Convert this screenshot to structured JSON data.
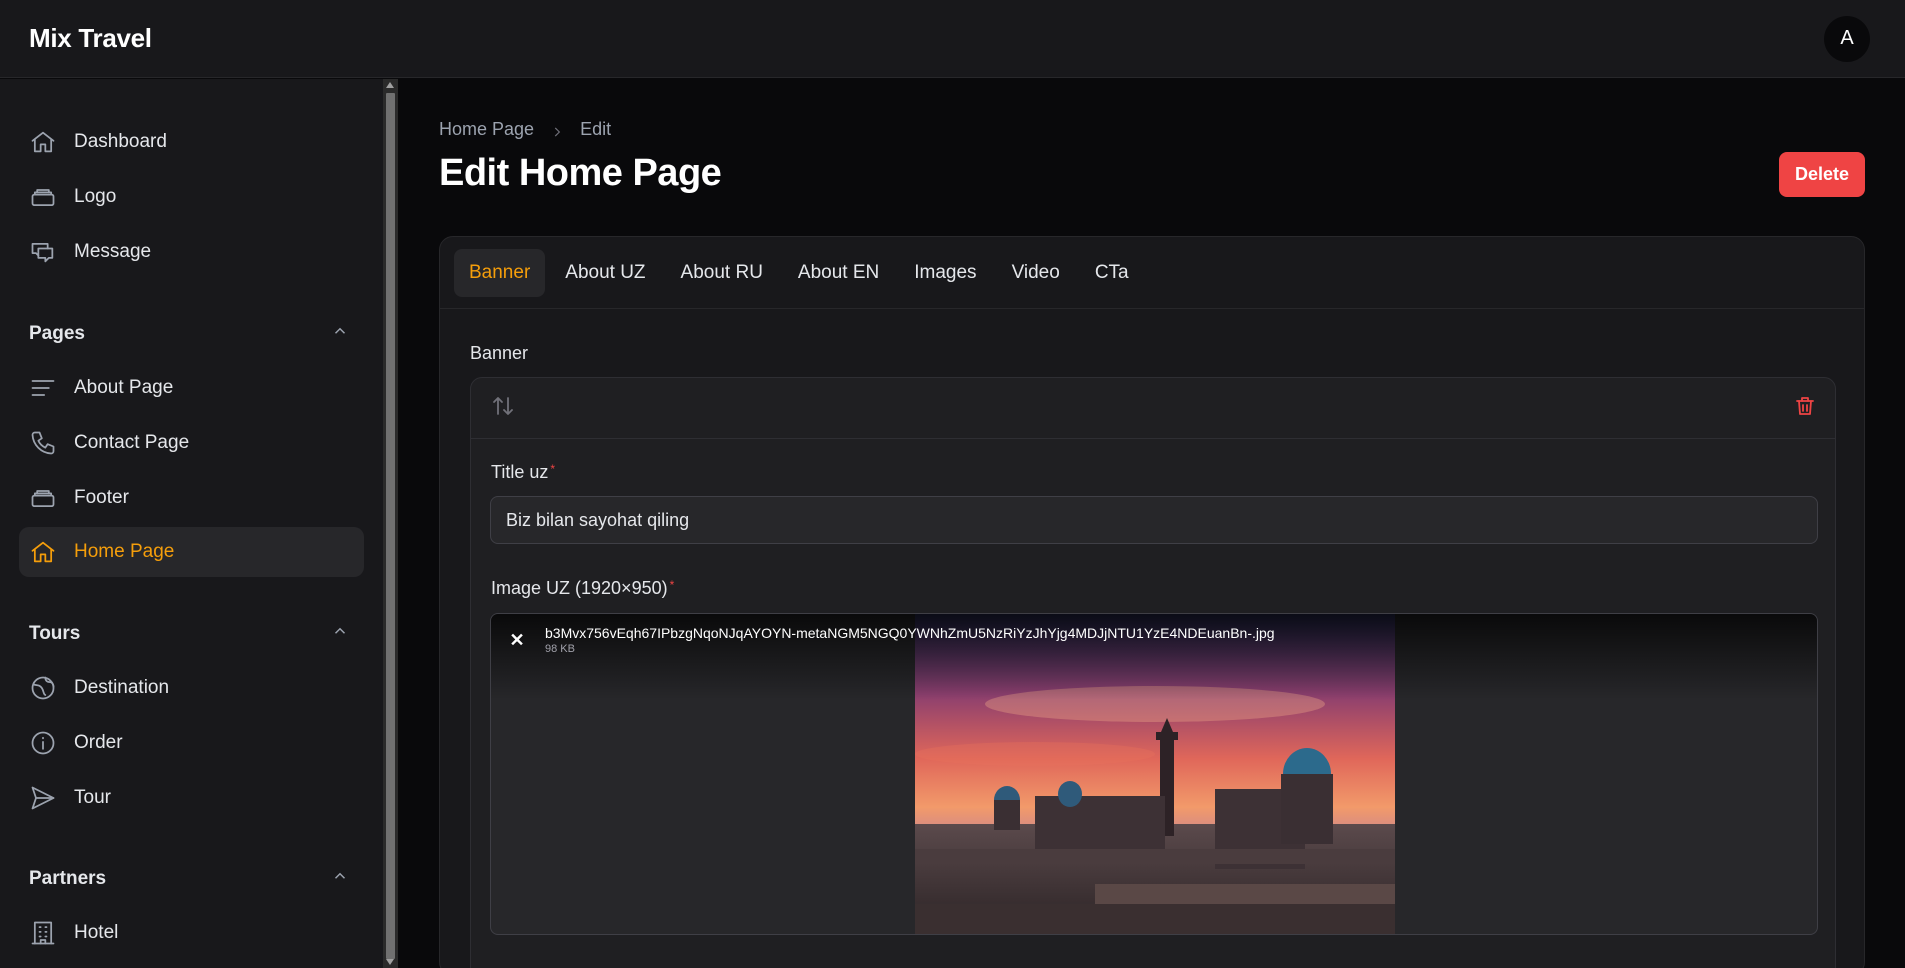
{
  "app": {
    "title": "Mix Travel",
    "avatar_initial": "A"
  },
  "sidebar": {
    "top_items": [
      {
        "label": "Dashboard",
        "icon": "home-icon"
      },
      {
        "label": "Logo",
        "icon": "stack-icon"
      },
      {
        "label": "Message",
        "icon": "chat-icon"
      }
    ],
    "groups": [
      {
        "title": "Pages",
        "items": [
          {
            "label": "About Page",
            "icon": "lines-icon"
          },
          {
            "label": "Contact Page",
            "icon": "phone-icon"
          },
          {
            "label": "Footer",
            "icon": "stack-icon"
          },
          {
            "label": "Home Page",
            "icon": "home-icon",
            "active": true
          }
        ]
      },
      {
        "title": "Tours",
        "items": [
          {
            "label": "Destination",
            "icon": "globe-icon"
          },
          {
            "label": "Order",
            "icon": "info-icon"
          },
          {
            "label": "Tour",
            "icon": "send-icon"
          }
        ]
      },
      {
        "title": "Partners",
        "items": [
          {
            "label": "Hotel",
            "icon": "building-icon"
          }
        ]
      }
    ]
  },
  "breadcrumb": {
    "parent": "Home Page",
    "current": "Edit"
  },
  "page": {
    "title": "Edit Home Page",
    "delete_label": "Delete"
  },
  "tabs": [
    {
      "label": "Banner",
      "active": true
    },
    {
      "label": "About UZ"
    },
    {
      "label": "About RU"
    },
    {
      "label": "About EN"
    },
    {
      "label": "Images"
    },
    {
      "label": "Video"
    },
    {
      "label": "CTa"
    }
  ],
  "form": {
    "section_label": "Banner",
    "title_label": "Title uz",
    "title_required": "*",
    "title_value": "Biz bilan sayohat qiling",
    "image_label": "Image UZ (1920×950)",
    "image_required": "*",
    "file": {
      "name": "b3Mvx756vEqh67IPbzgNqoNJqAYOYN-metaNGM5NGQ0YWNhZmU5NzRiYzJhYjg4MDJjNTU1YzE4NDEuanBn-.jpg",
      "size": "98 KB",
      "remove_symbol": "✕"
    }
  },
  "colors": {
    "accent": "#f59e0b",
    "danger": "#ef4444",
    "background": "#09090b",
    "panel": "#18181b"
  }
}
